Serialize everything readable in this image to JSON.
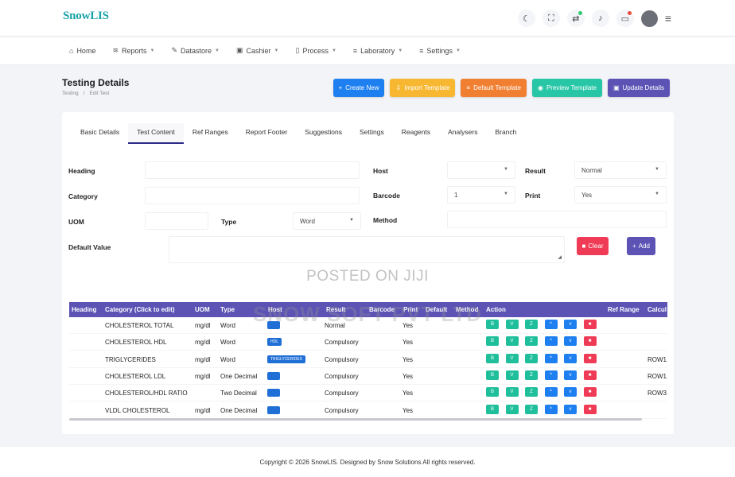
{
  "brand": {
    "logo": "SnowLIS"
  },
  "nav": [
    {
      "label": "Home",
      "icon": "home-icon",
      "glyph": "⌂",
      "caret": false
    },
    {
      "label": "Reports",
      "icon": "layers-icon",
      "glyph": "≋",
      "caret": true
    },
    {
      "label": "Datastore",
      "icon": "edit-icon",
      "glyph": "✎",
      "caret": true
    },
    {
      "label": "Cashier",
      "icon": "box-icon",
      "glyph": "▣",
      "caret": true
    },
    {
      "label": "Process",
      "icon": "file-icon",
      "glyph": "▯",
      "caret": true
    },
    {
      "label": "Laboratory",
      "icon": "database-icon",
      "glyph": "≡",
      "caret": true
    },
    {
      "label": "Settings",
      "icon": "database-icon",
      "glyph": "≡",
      "caret": true
    }
  ],
  "page": {
    "title": "Testing Details",
    "breadcrumb": [
      "Testing",
      "/",
      "Edit Test"
    ]
  },
  "actions": [
    {
      "label": "Create New",
      "glyph": "+",
      "color": "#1e7ff0"
    },
    {
      "label": "Import Template",
      "glyph": "⇩",
      "color": "#f7b731"
    },
    {
      "label": "Default Template",
      "glyph": "≡",
      "color": "#f07f32"
    },
    {
      "label": "Preview Template",
      "glyph": "◉",
      "color": "#26c6a6"
    },
    {
      "label": "Update Details",
      "glyph": "▣",
      "color": "#5c53b5"
    }
  ],
  "tabs": [
    "Basic Details",
    "Test Content",
    "Ref Ranges",
    "Report Footer",
    "Suggestions",
    "Settings",
    "Reagents",
    "Analysers",
    "Branch"
  ],
  "active_tab": "Test Content",
  "form": {
    "heading_label": "Heading",
    "category_label": "Category",
    "uom_label": "UOM",
    "type_label": "Type",
    "type_value": "Word",
    "default_value_label": "Default Value",
    "host_label": "Host",
    "barcode_label": "Barcode",
    "barcode_value": "1",
    "method_label": "Method",
    "result_label": "Result",
    "result_value": "Normal",
    "print_label": "Print",
    "print_value": "Yes",
    "clear_label": "Clear",
    "add_label": "Add"
  },
  "table": {
    "headers": [
      "Heading",
      "Category (Click to edit)",
      "UOM",
      "Type",
      "Host",
      "Result",
      "Barcode",
      "Print",
      "Default",
      "Method",
      "Action",
      "Ref Range",
      "Calcul"
    ],
    "rows": [
      {
        "category": "CHOLESTEROL TOTAL",
        "uom": "mg/dl",
        "type": "Word",
        "host": "",
        "result": "Normal",
        "print": "Yes",
        "calc": ""
      },
      {
        "category": "CHOLESTEROL HDL",
        "uom": "mg/dl",
        "type": "Word",
        "host": "HDL",
        "result": "Compulsory",
        "print": "Yes",
        "calc": ""
      },
      {
        "category": "TRIGLYCERIDES",
        "uom": "mg/dl",
        "type": "Word",
        "host": "TRIGLYCERIDES",
        "result": "Compulsory",
        "print": "Yes",
        "calc": "ROW1,"
      },
      {
        "category": "CHOLESTEROL LDL",
        "uom": "mg/dl",
        "type": "One Decimal",
        "host": "",
        "result": "Compulsory",
        "print": "Yes",
        "calc": "ROW1,"
      },
      {
        "category": "CHOLESTEROL/HDL RATIO",
        "uom": "",
        "type": "Two Decimal",
        "host": "",
        "result": "Compulsory",
        "print": "Yes",
        "calc": "ROW3,"
      },
      {
        "category": "VLDL CHOLESTEROL",
        "uom": "mg/dl",
        "type": "One Decimal",
        "host": "",
        "result": "Compulsory",
        "print": "Yes",
        "calc": ""
      }
    ],
    "action_buttons": [
      {
        "icon": "edit-icon",
        "glyph": "B",
        "color": "#1fbf9c"
      },
      {
        "icon": "view-icon",
        "glyph": "V",
        "color": "#1fbf9c"
      },
      {
        "icon": "link-icon",
        "glyph": "Z",
        "color": "#1fbf9c"
      },
      {
        "icon": "chevron-up-icon",
        "glyph": "^",
        "color": "#1e7ff0"
      },
      {
        "icon": "chevron-down-icon",
        "glyph": "v",
        "color": "#1e7ff0"
      },
      {
        "icon": "trash-icon",
        "glyph": "■",
        "color": "#ef3b55"
      }
    ]
  },
  "watermark": {
    "line1": "POSTED ON JIJI",
    "line2": "SNOW SOFT PVT LTD"
  },
  "footer": {
    "prefix": "Copyright © 2026",
    "brand1": "SnowLIS",
    "mid": ". Designed by",
    "brand2": "Snow Solutions",
    "suffix": "All rights reserved."
  }
}
